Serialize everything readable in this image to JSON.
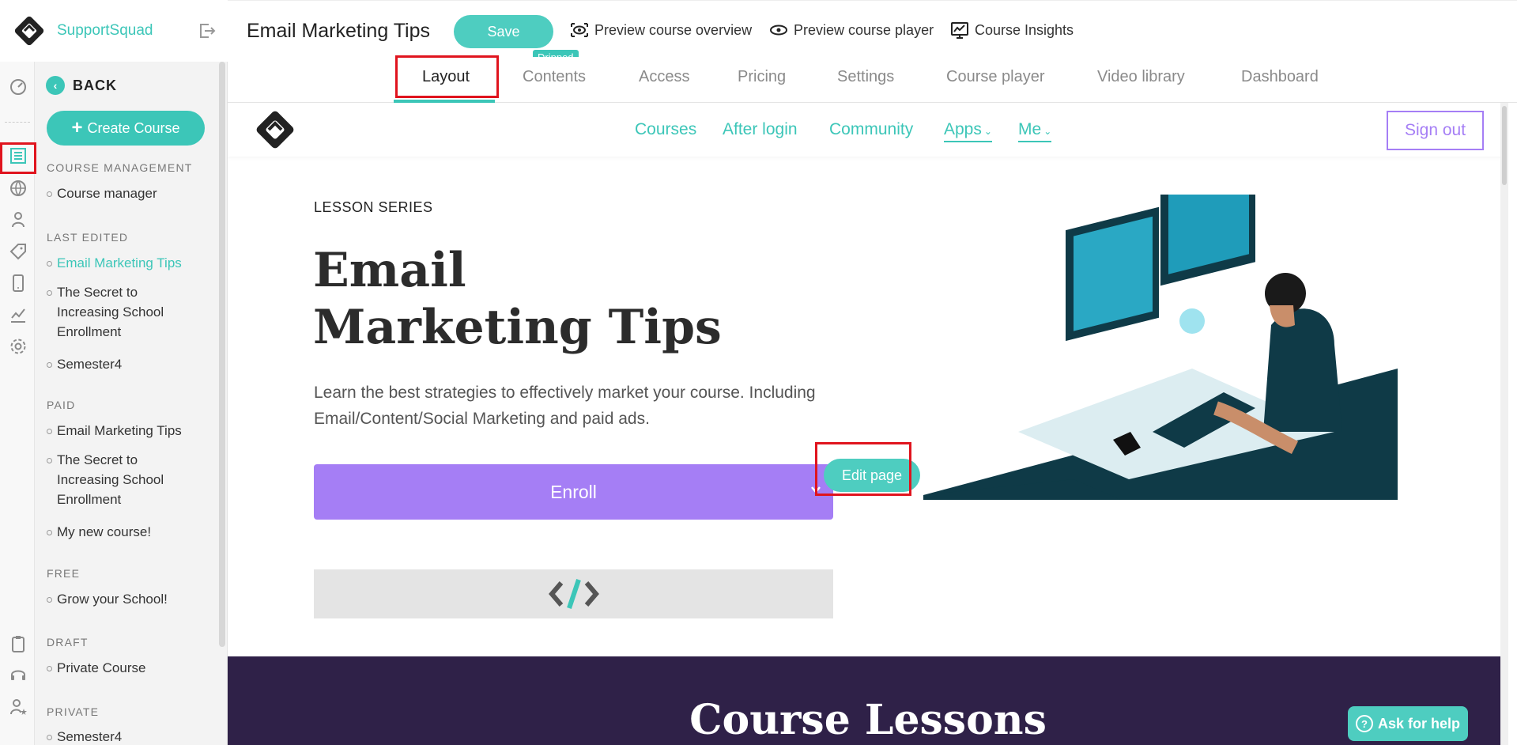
{
  "brand": {
    "name": "SupportSquad"
  },
  "sidebar": {
    "back_label": "BACK",
    "create_label": "Create Course",
    "sections": [
      {
        "title": "COURSE MANAGEMENT",
        "items": [
          "Course manager"
        ]
      },
      {
        "title": "LAST EDITED",
        "items": [
          "Email Marketing Tips",
          "The Secret to Increasing School Enrollment",
          "Semester4"
        ]
      },
      {
        "title": "PAID",
        "items": [
          "Email Marketing Tips",
          "The Secret to Increasing School Enrollment",
          "My new course!"
        ]
      },
      {
        "title": "FREE",
        "items": [
          "Grow your School!"
        ]
      },
      {
        "title": "DRAFT",
        "items": [
          "Private Course"
        ]
      },
      {
        "title": "PRIVATE",
        "items": [
          "Semester4"
        ]
      }
    ],
    "active_color": "#3cc6b8"
  },
  "rail_icons": [
    "dashboard-icon",
    "courses-icon",
    "globe-icon",
    "user-icon",
    "tag-icon",
    "mobile-icon",
    "analytics-icon",
    "settings-icon",
    "clipboard-icon",
    "headset-icon",
    "users-star-icon"
  ],
  "topbar": {
    "title": "Email Marketing Tips",
    "save_label": "Save",
    "dripped_label": "Dripped",
    "actions": [
      "Preview course overview",
      "Preview course player",
      "Course Insights"
    ]
  },
  "tabs": [
    "Layout",
    "Contents",
    "Access",
    "Pricing",
    "Settings",
    "Course player",
    "Video library",
    "Dashboard"
  ],
  "active_tab": "Layout",
  "site": {
    "nav": [
      "Courses",
      "After login",
      "Community",
      "Apps",
      "Me"
    ],
    "signout_label": "Sign out",
    "accent": "#3cc6b8",
    "purple": "#a57ef5"
  },
  "hero": {
    "eyebrow": "LESSON SERIES",
    "title": "Email Marketing Tips",
    "description": "Learn the best strategies to effectively market your course. Including Email/Content/Social Marketing and paid ads.",
    "enroll_label": "Enroll",
    "edit_label": "Edit page",
    "code_icon": "</>"
  },
  "lessons": {
    "title": "Course Lessons"
  },
  "help": {
    "label": "Ask for help"
  }
}
